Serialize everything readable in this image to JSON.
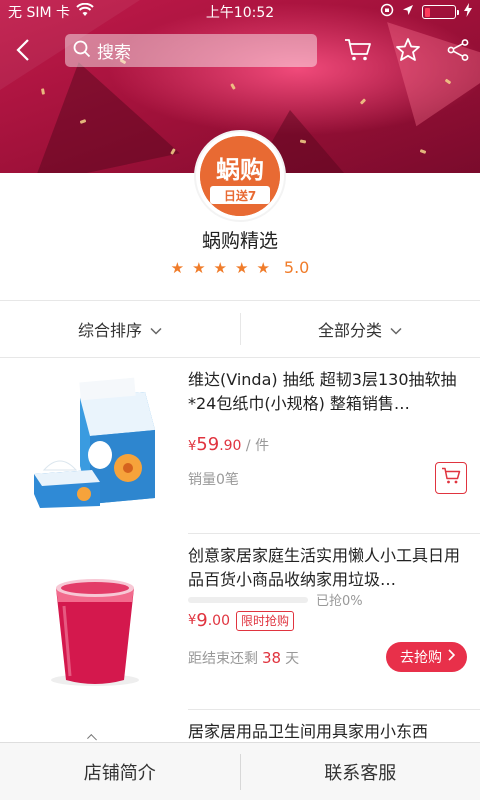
{
  "status_bar": {
    "carrier": "无 SIM 卡",
    "time": "上午10:52"
  },
  "nav": {
    "search_placeholder": "搜索",
    "icons": [
      "back-icon",
      "search-icon",
      "cart-icon",
      "star-icon",
      "share-icon"
    ]
  },
  "store": {
    "logo_text": "蜗购",
    "logo_sub": "日送7",
    "name": "蜗购精选",
    "rating": "5.0",
    "stars": 5
  },
  "filters": {
    "sort_label": "综合排序",
    "category_label": "全部分类"
  },
  "products": [
    {
      "title": "维达(Vinda) 抽纸 超韧3层130抽软抽*24包纸巾(小规格) 整箱销售…",
      "price_symbol": "¥",
      "price_int": "59",
      "price_dec": ".90",
      "unit": " / 件",
      "sales": "销量0笔"
    },
    {
      "title": "创意家居家庭生活实用懒人小工具日用品百货小商品收纳家用垃圾…",
      "progress_text": "已抢0%",
      "progress": 0,
      "price_symbol": "¥",
      "price_int": "9",
      "price_dec": ".00",
      "tag": "限时抢购",
      "countdown_prefix": "距结束还剩",
      "countdown_days": "38",
      "countdown_unit": "天",
      "button": "去抢购"
    },
    {
      "title": "居家居用品卫生间用具家用小东西"
    }
  ],
  "bottom_bar": {
    "left": "店铺简介",
    "right": "联系客服"
  },
  "colors": {
    "accent": "#e0343f",
    "rating": "#f07c2a",
    "banner": "#b0163f"
  }
}
